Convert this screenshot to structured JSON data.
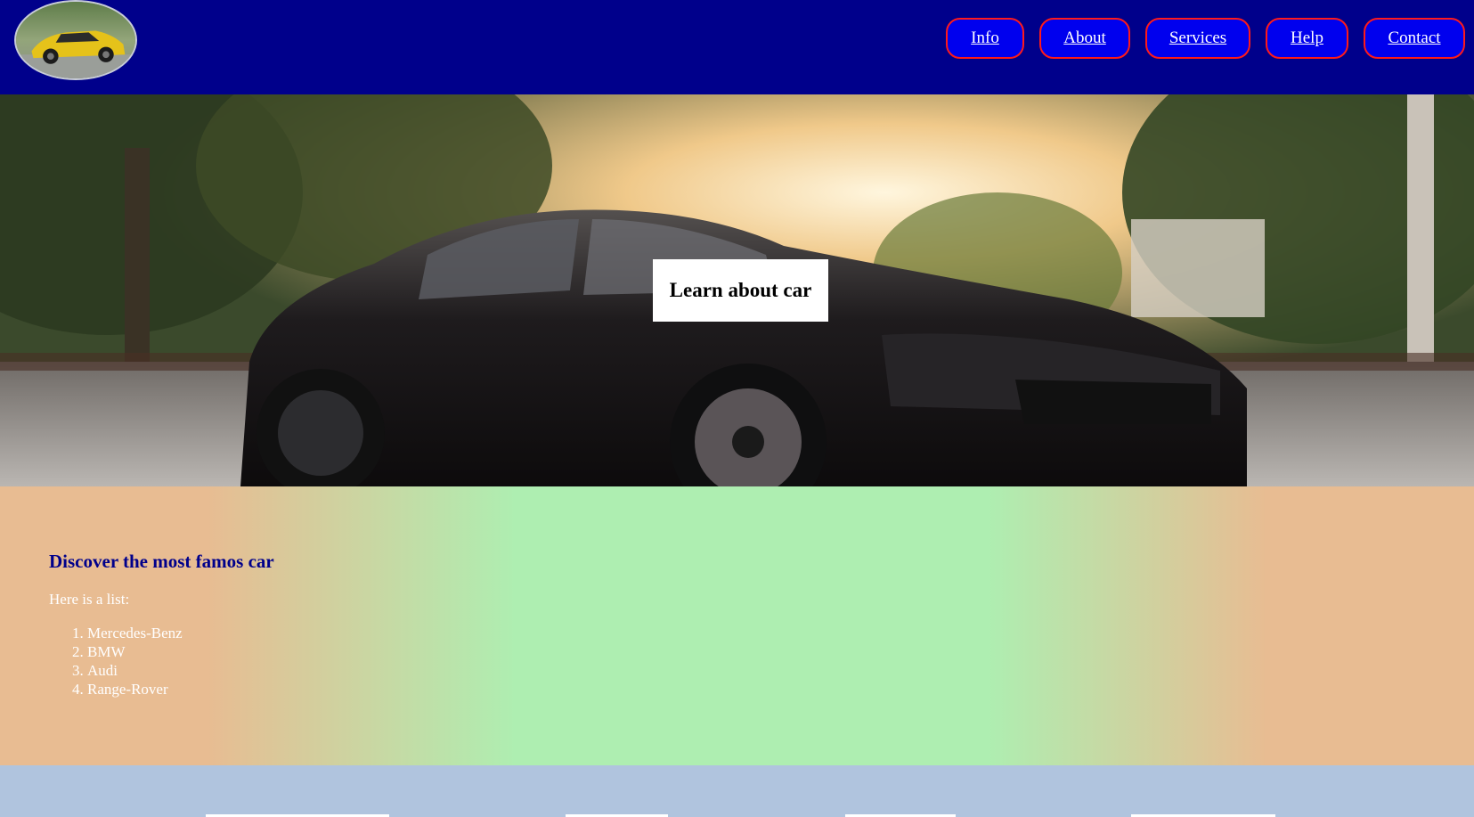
{
  "header": {
    "logo_icon": "yellow-sports-car-logo",
    "bg_color": "#00008b",
    "nav": [
      {
        "label": "Info"
      },
      {
        "label": "About"
      },
      {
        "label": "Services"
      },
      {
        "label": "Help"
      },
      {
        "label": "Contact"
      }
    ],
    "nav_border_color": "#ff1a1a"
  },
  "hero": {
    "image": "black-muscle-car-at-sunset",
    "cta_label": "Learn about car"
  },
  "content": {
    "heading": "Discover the most famos car",
    "intro": "Here is a list:",
    "items": [
      "Mercedes-Benz",
      "BMW",
      "Audi",
      "Range-Rover"
    ],
    "heading_color": "#00008b"
  },
  "footer": {
    "bg_color": "#b0c4de"
  }
}
